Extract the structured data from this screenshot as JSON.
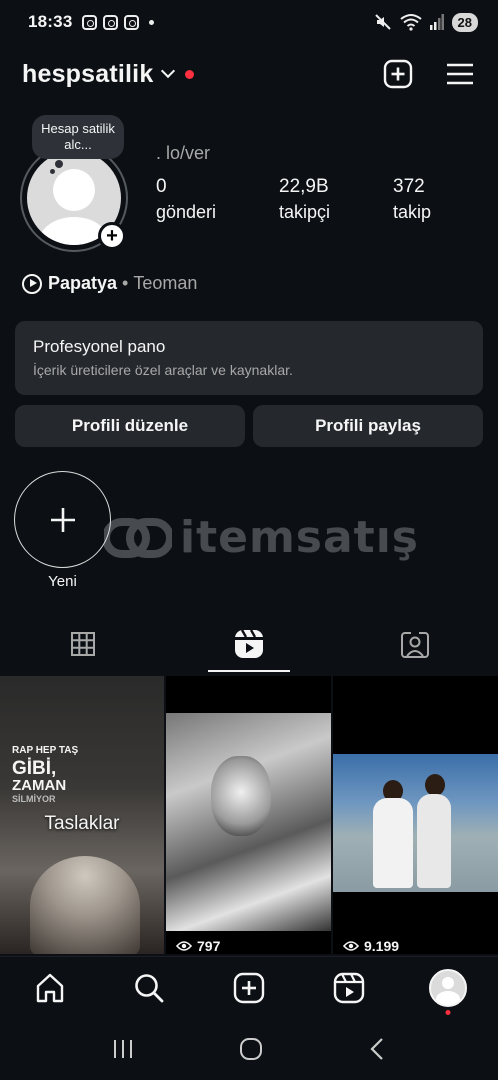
{
  "status_bar": {
    "time": "18:33",
    "battery": "28"
  },
  "header": {
    "username": "hespsatilik"
  },
  "profile": {
    "note": "Hesap satilik alc...",
    "full_name": ". lo/ver",
    "stats": [
      {
        "value": "0",
        "label": "gönderi"
      },
      {
        "value": "22,9B",
        "label": "takipçi"
      },
      {
        "value": "372",
        "label": "takip"
      }
    ],
    "music": {
      "song": "Papatya",
      "separator": "•",
      "artist": "Teoman"
    }
  },
  "pro_dashboard": {
    "title": "Profesyonel pano",
    "subtitle": "İçerik üreticilere özel araçlar ve kaynaklar."
  },
  "buttons": {
    "edit_profile": "Profili düzenle",
    "share_profile": "Profili paylaş"
  },
  "highlights": {
    "new_label": "Yeni"
  },
  "watermark": {
    "text": "itemsatış"
  },
  "grid": {
    "drafts_label": "Taslaklar",
    "overlay_text": {
      "line1": "RAP HEP TAŞ",
      "line2": "GİBİ,",
      "line3": "ZAMAN",
      "line4": "SİLMİYOR"
    },
    "items": [
      {
        "views": "797"
      },
      {
        "views": "9.199"
      }
    ]
  },
  "colors": {
    "background": "#0c1014",
    "card": "#25292e",
    "notification": "#ff3040",
    "secondary_text": "#a8a8a8"
  }
}
